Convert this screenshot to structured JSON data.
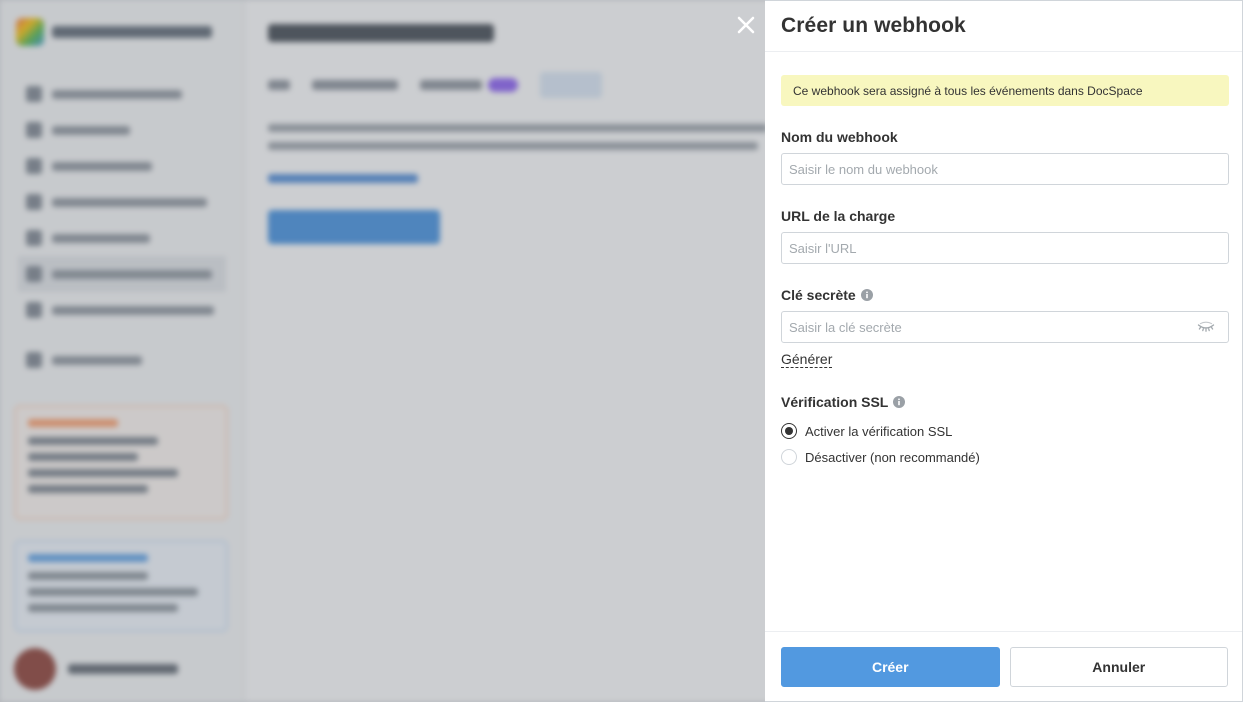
{
  "panel": {
    "title": "Créer un webhook",
    "notice": "Ce webhook sera assigné à tous les événements dans DocSpace"
  },
  "form": {
    "name": {
      "label": "Nom du webhook",
      "placeholder": "Saisir le nom du webhook",
      "value": ""
    },
    "url": {
      "label": "URL de la charge",
      "placeholder": "Saisir l'URL",
      "value": ""
    },
    "secret": {
      "label": "Clé secrète",
      "placeholder": "Saisir la clé secrète",
      "value": "",
      "generate_label": "Générer"
    },
    "ssl": {
      "label": "Vérification SSL",
      "options": [
        {
          "label": "Activer la vérification SSL",
          "selected": true
        },
        {
          "label": "Désactiver (non recommandé)",
          "selected": false
        }
      ]
    }
  },
  "footer": {
    "create_label": "Créer",
    "cancel_label": "Annuler"
  },
  "icons": {
    "close": "close-icon",
    "info": "info-icon",
    "eye": "eye-closed-icon"
  },
  "colors": {
    "primary": "#5299e0",
    "notice_bg": "#f8f7bf",
    "text": "#333333",
    "placeholder": "#a3a9ae"
  }
}
